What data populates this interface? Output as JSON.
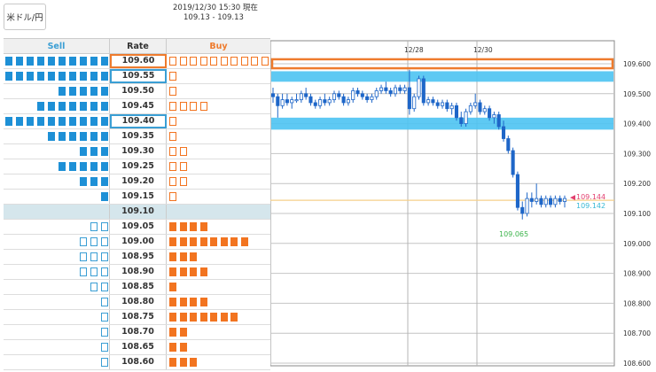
{
  "pair_button": {
    "label": "米ドル/円"
  },
  "timestamp": {
    "line1": "2019/12/30 15:30 現在",
    "line2": "109.13 - 109.13"
  },
  "order_book": {
    "headers": {
      "sell": "Sell",
      "rate": "Rate",
      "buy": "Buy"
    },
    "rows": [
      {
        "rate": "109.60",
        "sell": {
          "filled": 10,
          "empty": 0
        },
        "buy": {
          "filled": 0,
          "empty": 10
        },
        "highlight": "orange"
      },
      {
        "rate": "109.55",
        "sell": {
          "filled": 10,
          "empty": 0
        },
        "buy": {
          "filled": 0,
          "empty": 1
        },
        "highlight": "blue"
      },
      {
        "rate": "109.50",
        "sell": {
          "filled": 5,
          "empty": 0
        },
        "buy": {
          "filled": 0,
          "empty": 1
        },
        "highlight": ""
      },
      {
        "rate": "109.45",
        "sell": {
          "filled": 7,
          "empty": 0
        },
        "buy": {
          "filled": 0,
          "empty": 4
        },
        "highlight": ""
      },
      {
        "rate": "109.40",
        "sell": {
          "filled": 10,
          "empty": 0
        },
        "buy": {
          "filled": 0,
          "empty": 1
        },
        "highlight": "blue"
      },
      {
        "rate": "109.35",
        "sell": {
          "filled": 6,
          "empty": 0
        },
        "buy": {
          "filled": 0,
          "empty": 1
        },
        "highlight": ""
      },
      {
        "rate": "109.30",
        "sell": {
          "filled": 3,
          "empty": 0
        },
        "buy": {
          "filled": 0,
          "empty": 2
        },
        "highlight": ""
      },
      {
        "rate": "109.25",
        "sell": {
          "filled": 5,
          "empty": 0
        },
        "buy": {
          "filled": 0,
          "empty": 2
        },
        "highlight": ""
      },
      {
        "rate": "109.20",
        "sell": {
          "filled": 3,
          "empty": 0
        },
        "buy": {
          "filled": 0,
          "empty": 2
        },
        "highlight": ""
      },
      {
        "rate": "109.15",
        "sell": {
          "filled": 1,
          "empty": 0
        },
        "buy": {
          "filled": 0,
          "empty": 1
        },
        "highlight": ""
      },
      {
        "rate": "109.10",
        "sell": {
          "filled": 0,
          "empty": 0
        },
        "buy": {
          "filled": 0,
          "empty": 0
        },
        "highlight": "",
        "mid": true
      },
      {
        "rate": "109.05",
        "sell": {
          "filled": 0,
          "empty": 2
        },
        "buy": {
          "filled": 4,
          "empty": 0
        },
        "highlight": ""
      },
      {
        "rate": "109.00",
        "sell": {
          "filled": 0,
          "empty": 3
        },
        "buy": {
          "filled": 8,
          "empty": 0
        },
        "highlight": ""
      },
      {
        "rate": "108.95",
        "sell": {
          "filled": 0,
          "empty": 3
        },
        "buy": {
          "filled": 3,
          "empty": 0
        },
        "highlight": ""
      },
      {
        "rate": "108.90",
        "sell": {
          "filled": 0,
          "empty": 3
        },
        "buy": {
          "filled": 4,
          "empty": 0
        },
        "highlight": ""
      },
      {
        "rate": "108.85",
        "sell": {
          "filled": 0,
          "empty": 2
        },
        "buy": {
          "filled": 1,
          "empty": 0
        },
        "highlight": ""
      },
      {
        "rate": "108.80",
        "sell": {
          "filled": 0,
          "empty": 1
        },
        "buy": {
          "filled": 4,
          "empty": 0
        },
        "highlight": ""
      },
      {
        "rate": "108.75",
        "sell": {
          "filled": 0,
          "empty": 1
        },
        "buy": {
          "filled": 7,
          "empty": 0
        },
        "highlight": ""
      },
      {
        "rate": "108.70",
        "sell": {
          "filled": 0,
          "empty": 1
        },
        "buy": {
          "filled": 2,
          "empty": 0
        },
        "highlight": ""
      },
      {
        "rate": "108.65",
        "sell": {
          "filled": 0,
          "empty": 1
        },
        "buy": {
          "filled": 2,
          "empty": 0
        },
        "highlight": ""
      },
      {
        "rate": "108.60",
        "sell": {
          "filled": 0,
          "empty": 1
        },
        "buy": {
          "filled": 3,
          "empty": 0
        },
        "highlight": ""
      }
    ]
  },
  "colors": {
    "sell": "#1e90d6",
    "buy": "#f27420",
    "band": "#4dc3f2",
    "ask": "#e23f6f",
    "bid": "#37b8d6",
    "low": "#3cb44b",
    "candle": "#1e66c8"
  },
  "chart_data": {
    "type": "candlestick",
    "x_labels": [
      "12/28",
      "12/30"
    ],
    "y_ticks": [
      "109.600",
      "109.500",
      "109.400",
      "109.300",
      "109.200",
      "109.100",
      "109.000",
      "108.900",
      "108.800",
      "108.700",
      "108.600"
    ],
    "ylim": [
      108.6,
      109.6
    ],
    "ask_label": "109.144",
    "bid_label": "109.142",
    "low_label": "109.065",
    "bands": [
      {
        "from": 109.54,
        "to": 109.575
      },
      {
        "from": 109.38,
        "to": 109.42
      }
    ],
    "ask": 109.144,
    "bid": 109.142,
    "low": 109.065,
    "close": 109.13,
    "candles": [
      {
        "o": 109.5,
        "h": 109.52,
        "l": 109.47,
        "c": 109.49
      },
      {
        "o": 109.49,
        "h": 109.5,
        "l": 109.42,
        "c": 109.46
      },
      {
        "o": 109.46,
        "h": 109.5,
        "l": 109.45,
        "c": 109.48
      },
      {
        "o": 109.48,
        "h": 109.5,
        "l": 109.46,
        "c": 109.47
      },
      {
        "o": 109.47,
        "h": 109.49,
        "l": 109.45,
        "c": 109.48
      },
      {
        "o": 109.48,
        "h": 109.5,
        "l": 109.47,
        "c": 109.48
      },
      {
        "o": 109.48,
        "h": 109.51,
        "l": 109.47,
        "c": 109.5
      },
      {
        "o": 109.5,
        "h": 109.52,
        "l": 109.48,
        "c": 109.49
      },
      {
        "o": 109.49,
        "h": 109.5,
        "l": 109.46,
        "c": 109.47
      },
      {
        "o": 109.47,
        "h": 109.48,
        "l": 109.45,
        "c": 109.46
      },
      {
        "o": 109.46,
        "h": 109.49,
        "l": 109.45,
        "c": 109.48
      },
      {
        "o": 109.48,
        "h": 109.5,
        "l": 109.46,
        "c": 109.47
      },
      {
        "o": 109.47,
        "h": 109.49,
        "l": 109.46,
        "c": 109.48
      },
      {
        "o": 109.48,
        "h": 109.51,
        "l": 109.47,
        "c": 109.5
      },
      {
        "o": 109.5,
        "h": 109.51,
        "l": 109.48,
        "c": 109.49
      },
      {
        "o": 109.49,
        "h": 109.5,
        "l": 109.46,
        "c": 109.47
      },
      {
        "o": 109.47,
        "h": 109.49,
        "l": 109.46,
        "c": 109.48
      },
      {
        "o": 109.48,
        "h": 109.52,
        "l": 109.47,
        "c": 109.51
      },
      {
        "o": 109.51,
        "h": 109.52,
        "l": 109.49,
        "c": 109.5
      },
      {
        "o": 109.5,
        "h": 109.51,
        "l": 109.48,
        "c": 109.49
      },
      {
        "o": 109.49,
        "h": 109.5,
        "l": 109.47,
        "c": 109.48
      },
      {
        "o": 109.48,
        "h": 109.5,
        "l": 109.47,
        "c": 109.49
      },
      {
        "o": 109.49,
        "h": 109.52,
        "l": 109.48,
        "c": 109.51
      },
      {
        "o": 109.51,
        "h": 109.53,
        "l": 109.5,
        "c": 109.52
      },
      {
        "o": 109.52,
        "h": 109.54,
        "l": 109.5,
        "c": 109.51
      },
      {
        "o": 109.51,
        "h": 109.52,
        "l": 109.49,
        "c": 109.5
      },
      {
        "o": 109.5,
        "h": 109.53,
        "l": 109.49,
        "c": 109.52
      },
      {
        "o": 109.52,
        "h": 109.53,
        "l": 109.5,
        "c": 109.51
      },
      {
        "o": 109.51,
        "h": 109.53,
        "l": 109.5,
        "c": 109.52
      },
      {
        "o": 109.52,
        "h": 109.58,
        "l": 109.43,
        "c": 109.45
      },
      {
        "o": 109.45,
        "h": 109.5,
        "l": 109.44,
        "c": 109.49
      },
      {
        "o": 109.49,
        "h": 109.56,
        "l": 109.48,
        "c": 109.55
      },
      {
        "o": 109.55,
        "h": 109.56,
        "l": 109.46,
        "c": 109.47
      },
      {
        "o": 109.47,
        "h": 109.49,
        "l": 109.46,
        "c": 109.48
      },
      {
        "o": 109.48,
        "h": 109.49,
        "l": 109.46,
        "c": 109.47
      },
      {
        "o": 109.47,
        "h": 109.48,
        "l": 109.45,
        "c": 109.46
      },
      {
        "o": 109.46,
        "h": 109.48,
        "l": 109.45,
        "c": 109.47
      },
      {
        "o": 109.47,
        "h": 109.48,
        "l": 109.44,
        "c": 109.45
      },
      {
        "o": 109.45,
        "h": 109.47,
        "l": 109.43,
        "c": 109.46
      },
      {
        "o": 109.46,
        "h": 109.47,
        "l": 109.41,
        "c": 109.42
      },
      {
        "o": 109.42,
        "h": 109.44,
        "l": 109.39,
        "c": 109.4
      },
      {
        "o": 109.4,
        "h": 109.45,
        "l": 109.39,
        "c": 109.44
      },
      {
        "o": 109.44,
        "h": 109.47,
        "l": 109.43,
        "c": 109.46
      },
      {
        "o": 109.46,
        "h": 109.5,
        "l": 109.45,
        "c": 109.47
      },
      {
        "o": 109.47,
        "h": 109.48,
        "l": 109.43,
        "c": 109.44
      },
      {
        "o": 109.44,
        "h": 109.46,
        "l": 109.43,
        "c": 109.45
      },
      {
        "o": 109.45,
        "h": 109.46,
        "l": 109.41,
        "c": 109.42
      },
      {
        "o": 109.42,
        "h": 109.44,
        "l": 109.4,
        "c": 109.43
      },
      {
        "o": 109.43,
        "h": 109.44,
        "l": 109.38,
        "c": 109.39
      },
      {
        "o": 109.39,
        "h": 109.41,
        "l": 109.34,
        "c": 109.35
      },
      {
        "o": 109.35,
        "h": 109.36,
        "l": 109.3,
        "c": 109.31
      },
      {
        "o": 109.31,
        "h": 109.32,
        "l": 109.22,
        "c": 109.23
      },
      {
        "o": 109.23,
        "h": 109.24,
        "l": 109.11,
        "c": 109.12
      },
      {
        "o": 109.12,
        "h": 109.14,
        "l": 109.08,
        "c": 109.1
      },
      {
        "o": 109.1,
        "h": 109.17,
        "l": 109.09,
        "c": 109.15
      },
      {
        "o": 109.15,
        "h": 109.17,
        "l": 109.12,
        "c": 109.14
      },
      {
        "o": 109.14,
        "h": 109.2,
        "l": 109.13,
        "c": 109.15
      },
      {
        "o": 109.15,
        "h": 109.16,
        "l": 109.12,
        "c": 109.13
      },
      {
        "o": 109.13,
        "h": 109.16,
        "l": 109.12,
        "c": 109.15
      },
      {
        "o": 109.15,
        "h": 109.16,
        "l": 109.12,
        "c": 109.13
      },
      {
        "o": 109.13,
        "h": 109.16,
        "l": 109.12,
        "c": 109.15
      },
      {
        "o": 109.15,
        "h": 109.16,
        "l": 109.13,
        "c": 109.14
      },
      {
        "o": 109.14,
        "h": 109.16,
        "l": 109.12,
        "c": 109.15
      }
    ]
  }
}
